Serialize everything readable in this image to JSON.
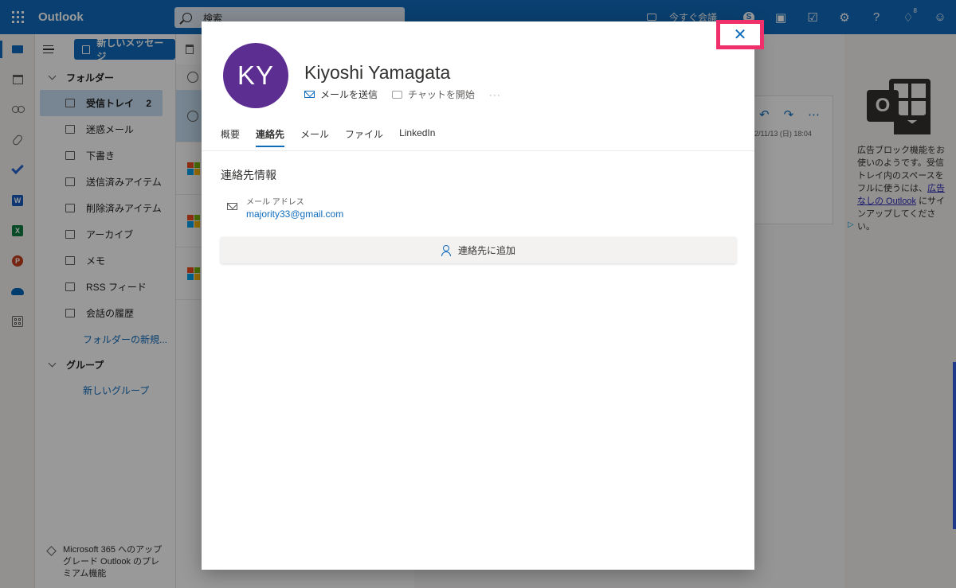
{
  "topbar": {
    "app_name": "Outlook",
    "search_placeholder": "検索",
    "meet_now": "今すぐ会議",
    "skype_letter": "S",
    "tips_badge": "8"
  },
  "folders": {
    "new_message": "新しいメッセージ",
    "folders_header": "フォルダー",
    "items": [
      {
        "label": "受信トレイ",
        "count": "2"
      },
      {
        "label": "迷惑メール"
      },
      {
        "label": "下書き"
      },
      {
        "label": "送信済みアイテム"
      },
      {
        "label": "削除済みアイテム"
      },
      {
        "label": "アーカイブ"
      },
      {
        "label": "メモ"
      },
      {
        "label": "RSS フィード"
      },
      {
        "label": "会話の履歴"
      }
    ],
    "new_folder": "フォルダーの新規...",
    "groups_header": "グループ",
    "new_group": "新しいグループ",
    "upgrade_text": "Microsoft 365 へのアップグレード Outlook のプレミアム機能"
  },
  "reading": {
    "date": "2/11/13 (日) 18:04"
  },
  "ad": {
    "logo_letter": "O",
    "text_before": "広告ブロック機能をお使いのようです。受信トレイ内のスペースをフルに使うには、",
    "link": "広告なしの Outlook",
    "text_after": " にサインアップしてください。",
    "choice": "▷"
  },
  "contact": {
    "initials": "KY",
    "name": "Kiyoshi Yamagata",
    "avatar_color": "#5c2e91",
    "send_mail": "メールを送信",
    "start_chat": "チャットを開始",
    "more": "···",
    "tabs": [
      "概要",
      "連絡先",
      "メール",
      "ファイル",
      "LinkedIn"
    ],
    "active_tab": "連絡先",
    "section_title": "連絡先情報",
    "email_label": "メール アドレス",
    "email_value": "majority33@gmail.com",
    "add_contact": "連絡先に追加",
    "close": "✕"
  },
  "colors": {
    "brand": "#0f6cbd",
    "highlight": "#f0306a"
  }
}
